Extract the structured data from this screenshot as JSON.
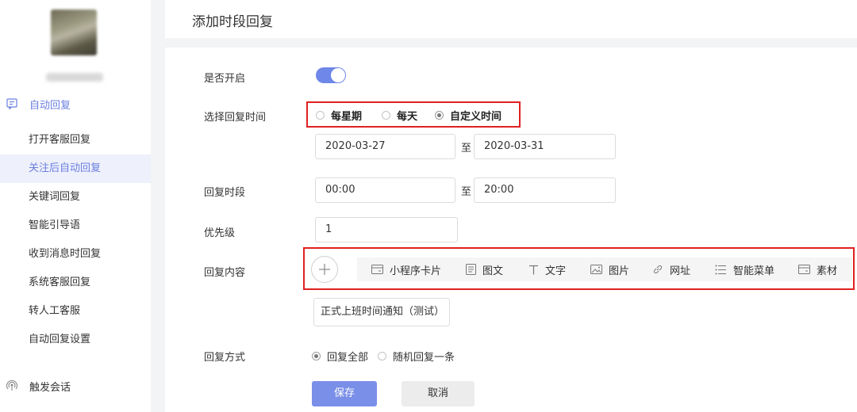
{
  "header": {
    "title": "添加时段回复"
  },
  "sidebar": {
    "group_auto_reply": "自动回复",
    "items": [
      {
        "label": "打开客服回复"
      },
      {
        "label": "关注后自动回复"
      },
      {
        "label": "关键词回复"
      },
      {
        "label": "智能引导语"
      },
      {
        "label": "收到消息时回复"
      },
      {
        "label": "系统客服回复"
      },
      {
        "label": "转人工客服"
      },
      {
        "label": "自动回复设置"
      }
    ],
    "active_index": 1,
    "group_trigger": "触发会话"
  },
  "form": {
    "enable_label": "是否开启",
    "enabled": true,
    "time_label": "选择回复时间",
    "time_options": [
      {
        "label": "每星期",
        "checked": false
      },
      {
        "label": "每天",
        "checked": false
      },
      {
        "label": "自定义时间",
        "checked": true
      }
    ],
    "date_start": "2020-03-27",
    "date_end": "2020-03-31",
    "to_text": "至",
    "period_label": "回复时段",
    "time_start": "00:00",
    "time_end": "20:00",
    "priority_label": "优先级",
    "priority_value": "1",
    "content_label": "回复内容",
    "content_tools": [
      {
        "label": "小程序卡片",
        "icon": "card-icon"
      },
      {
        "label": "图文",
        "icon": "article-icon"
      },
      {
        "label": "文字",
        "icon": "text-icon"
      },
      {
        "label": "图片",
        "icon": "image-icon"
      },
      {
        "label": "网址",
        "icon": "link-icon"
      },
      {
        "label": "智能菜单",
        "icon": "list-icon"
      },
      {
        "label": "素材",
        "icon": "material-icon"
      }
    ],
    "content_item": "正式上班时间通知（测试）",
    "mode_label": "回复方式",
    "mode_options": [
      {
        "label": "回复全部",
        "checked": true
      },
      {
        "label": "随机回复一条",
        "checked": false
      }
    ],
    "save_label": "保存",
    "cancel_label": "取消"
  },
  "colors": {
    "accent": "#6f87e8",
    "highlight_border": "#e02020",
    "active_bg": "#eef0fb"
  }
}
